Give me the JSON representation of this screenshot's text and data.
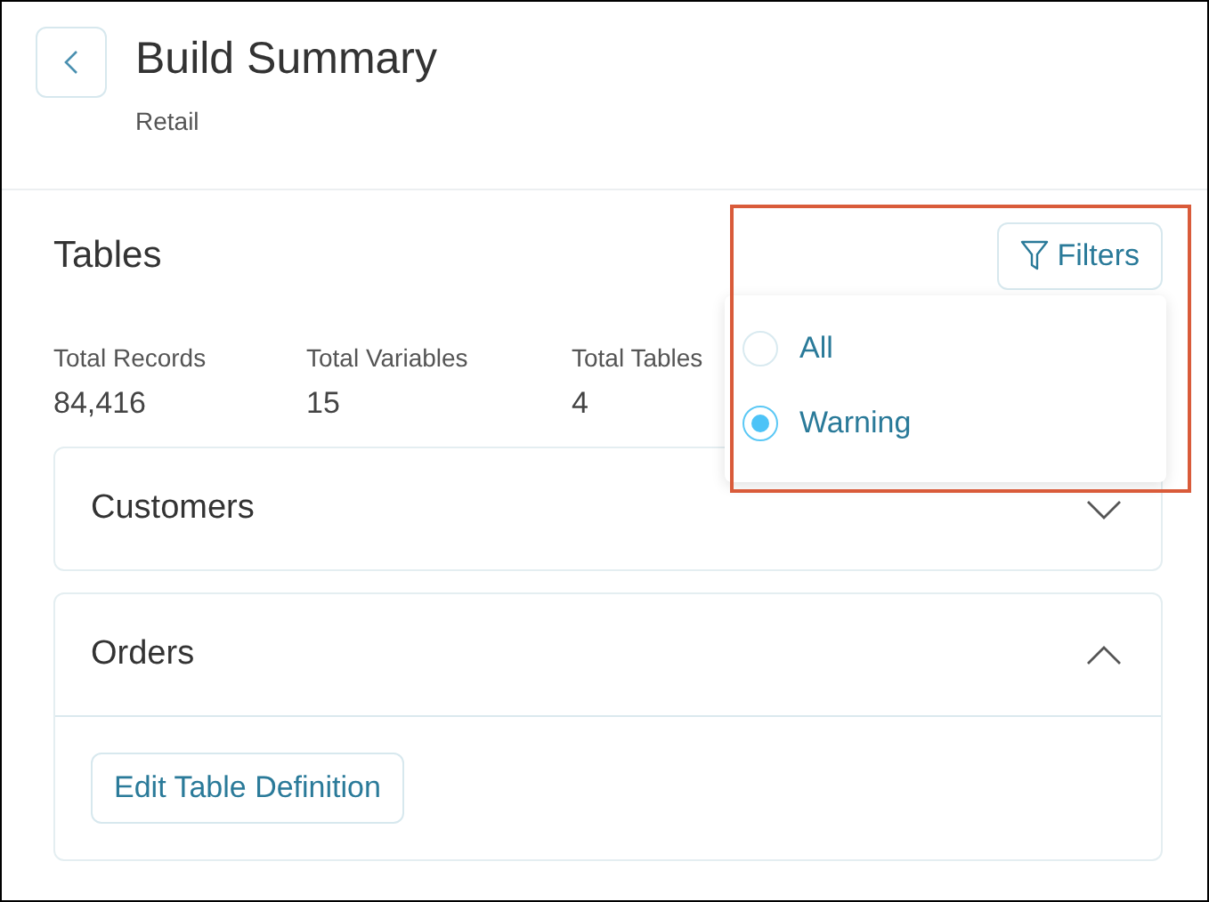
{
  "header": {
    "title": "Build Summary",
    "subtitle": "Retail"
  },
  "section": {
    "title": "Tables",
    "filter_button": "Filters"
  },
  "stats": [
    {
      "label": "Total Records",
      "value": "84,416"
    },
    {
      "label": "Total Variables",
      "value": "15"
    },
    {
      "label": "Total Tables",
      "value": "4"
    }
  ],
  "filter_menu": [
    {
      "label": "All",
      "selected": false
    },
    {
      "label": "Warning",
      "selected": true
    }
  ],
  "tables": [
    {
      "name": "Customers",
      "expanded": false
    },
    {
      "name": "Orders",
      "expanded": true,
      "action": "Edit Table Definition"
    }
  ]
}
